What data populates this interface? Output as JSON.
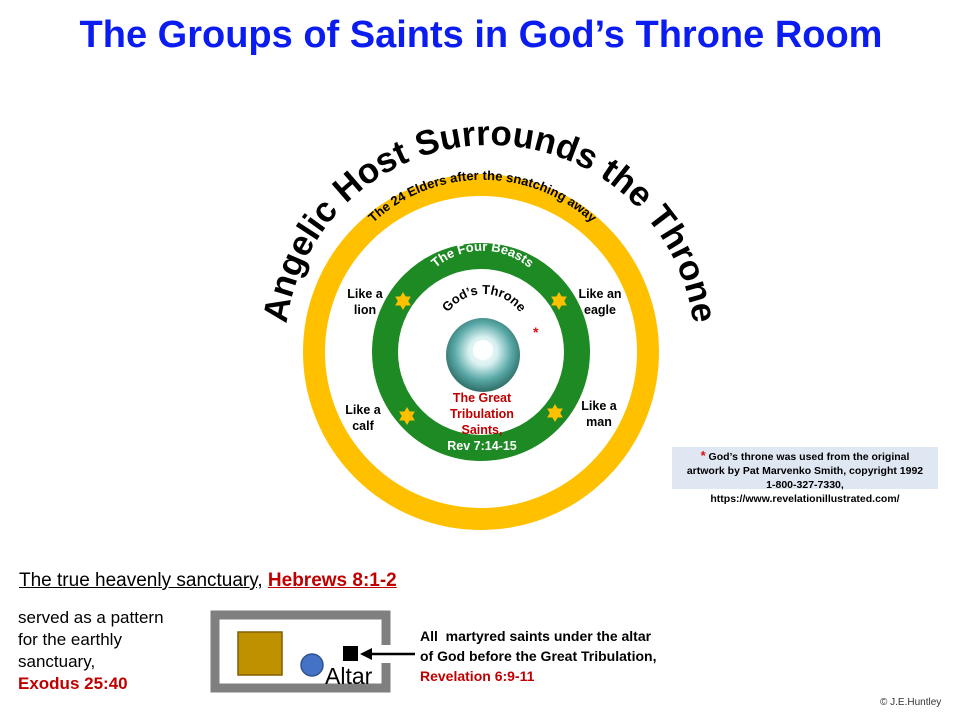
{
  "title": "The Groups of Saints in God’s Throne Room",
  "diagram": {
    "outer_arc_text": "Angelic Host Surrounds the Throne",
    "elders_text": "The 24 Elders after the snatching away",
    "beasts_text": "The Four Beasts",
    "throne_text": "God’s Throne",
    "beasts": {
      "lion": [
        "Like a",
        "lion"
      ],
      "eagle": [
        "Like an",
        "eagle"
      ],
      "calf": [
        "Like a",
        "calf"
      ],
      "man": [
        "Like a",
        "man"
      ]
    },
    "tribulation": [
      "The Great",
      "Tribulation",
      "Saints,"
    ],
    "tribulation_ref": "Rev 7:14-15",
    "colors": {
      "elders_ring": "#ffc000",
      "beasts_ring": "#1e8a24",
      "title": "#0a1cf0",
      "reference": "#c00000"
    }
  },
  "note": {
    "asterisk": "*",
    "line1": "God’s throne was used from the original",
    "line2": "artwork by Pat Marvenko Smith, copyright 1992",
    "line3": "1-800-327-7330, https://www.revelationillustrated.com/"
  },
  "sanctuary": {
    "label": "The true heavenly sanctuary,",
    "ref": "Hebrews 8:1-2",
    "pattern_lines": [
      "served as a pattern",
      "for the earthly",
      "sanctuary,"
    ],
    "pattern_ref": "Exodus 25:40",
    "altar_label": "Altar",
    "martyr_lines": [
      "All  martyred saints under the altar",
      "of God before the Great Tribulation,"
    ],
    "martyr_ref": "Revelation 6:9-11"
  },
  "copyright": "©  J.E.Huntley"
}
